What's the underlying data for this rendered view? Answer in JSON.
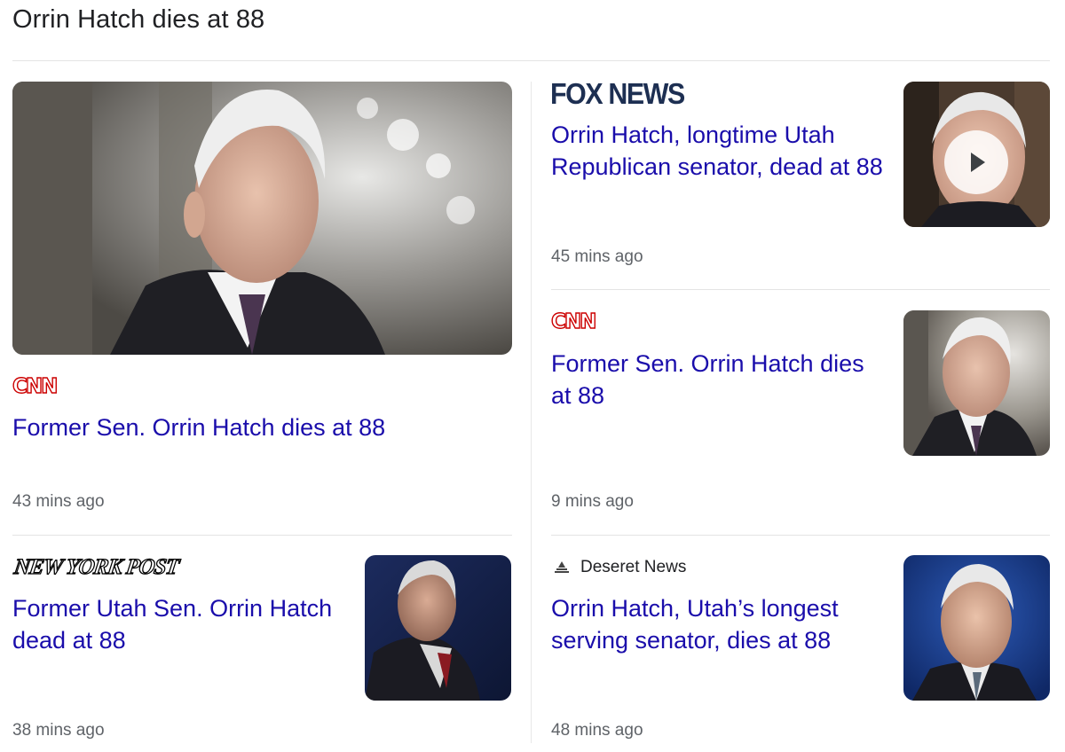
{
  "heading": "Orrin Hatch dies at 88",
  "stories": [
    {
      "source": "CNN",
      "headline": "Former Sen. Orrin Hatch dies at 88",
      "time": "43 mins ago"
    },
    {
      "source": "FOX NEWS",
      "headline": "Orrin Hatch, longtime Utah Republican senator, dead at 88",
      "time": "45 mins ago",
      "has_video": true
    },
    {
      "source": "CNN",
      "headline": "Former Sen. Orrin Hatch dies at 88",
      "time": "9 mins ago"
    },
    {
      "source": "NEW YORK POST",
      "headline": "Former Utah Sen. Orrin Hatch dead at 88",
      "time": "38 mins ago"
    },
    {
      "source": "Deseret News",
      "headline": "Orrin Hatch, Utah’s longest serving senator, dies at 88",
      "time": "48 mins ago"
    }
  ],
  "icons": {
    "play": "play-icon",
    "deseret": "deseret-news-logo-icon"
  },
  "colors": {
    "headline": "#1a0dab",
    "meta": "#5f6368",
    "cnn": "#cc0000",
    "fox": "#1d2f52"
  }
}
